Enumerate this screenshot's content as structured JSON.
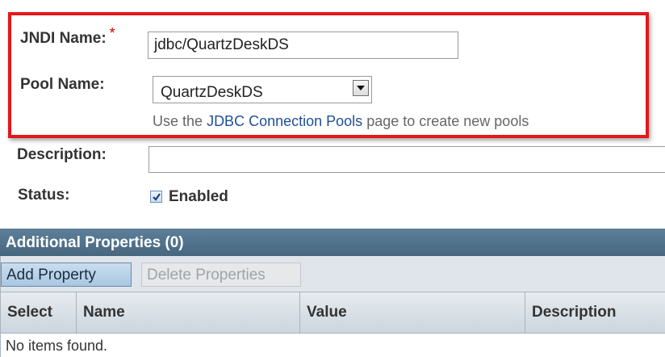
{
  "form": {
    "jndi_label": "JNDI Name:",
    "required_mark": "*",
    "jndi_value": "jdbc/QuartzDeskDS",
    "pool_label": "Pool Name:",
    "pool_selected": "QuartzDeskDS",
    "pool_help_prefix": "Use the",
    "pool_help_link": "JDBC Connection Pools",
    "pool_help_suffix": "page to create new pools",
    "description_label": "Description:",
    "description_value": "",
    "status_label": "Status:",
    "status_checkbox_label": "Enabled",
    "status_checked": true
  },
  "properties": {
    "title": "Additional Properties (0)",
    "add_button": "Add Property",
    "delete_button": "Delete Properties",
    "columns": [
      "Select",
      "Name",
      "Value",
      "Description"
    ],
    "empty_text": "No items found."
  },
  "colors": {
    "highlight_border": "#e4171b",
    "required": "#cc0000",
    "link": "#1f4f9a",
    "table_title_bg": "#4f7089"
  },
  "icons": {
    "dropdown": "chevron-down-icon",
    "checkbox": "checkmark-icon"
  }
}
